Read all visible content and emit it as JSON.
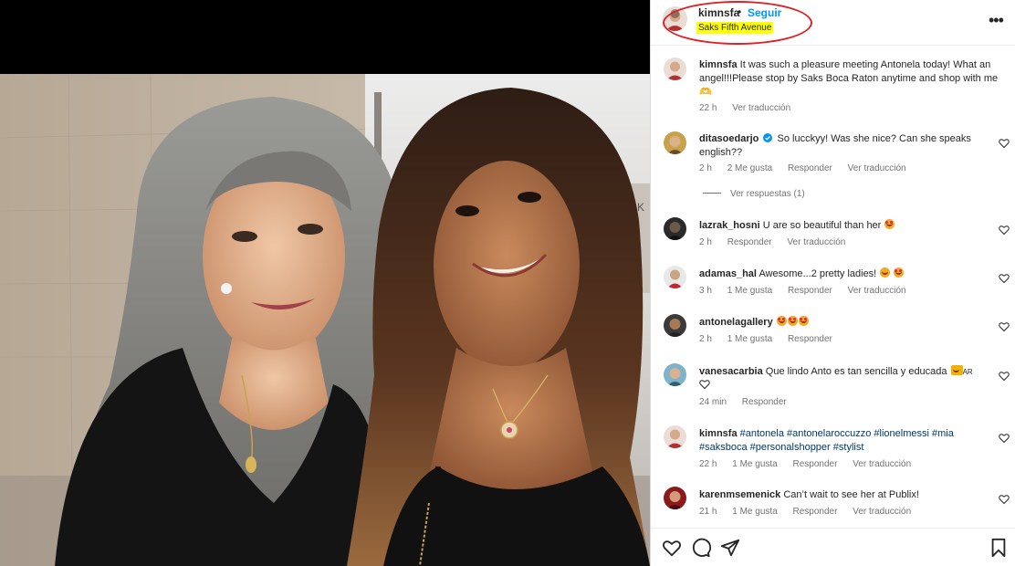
{
  "header": {
    "username": "kimnsfa",
    "separator": "•",
    "follow_label": "Seguir",
    "location": "Saks Fifth Avenue",
    "more_label": "•••"
  },
  "caption": {
    "username": "kimnsfa",
    "text": "It was such a pleasure meeting Antonela today! What an angel!!!Please stop by Saks Boca Raton anytime and shop with me 🫶",
    "time": "22 h",
    "translate": "Ver traducción"
  },
  "comments": [
    {
      "username": "ditasoedarjo",
      "verified": true,
      "text": "So lucckyy! Was she nice? Can she speaks english??",
      "time": "2 h",
      "likes": "2 Me gusta",
      "reply": "Responder",
      "translate": "Ver traducción",
      "view_replies": "Ver respuestas (1)"
    },
    {
      "username": "lazrak_hosni",
      "text": "U are so beautiful than her",
      "time": "2 h",
      "reply": "Responder",
      "translate": "Ver traducción"
    },
    {
      "username": "adamas_hal",
      "text": "Awesome...2 pretty ladies!",
      "time": "3 h",
      "likes": "1 Me gusta",
      "reply": "Responder",
      "translate": "Ver traducción"
    },
    {
      "username": "antonelagallery",
      "text": "",
      "time": "2 h",
      "likes": "1 Me gusta",
      "reply": "Responder"
    },
    {
      "username": "vanesacarbia",
      "text": "Que lindo Anto es tan sencilla y educada",
      "suffix": "AR",
      "time": "24 min",
      "reply": "Responder"
    },
    {
      "username": "kimnsfa",
      "hashtags_line1": "#antonela #antonelaroccuzzo #lionelmessi #mia",
      "hashtags_line2": "#saksboca #personalshopper #stylist",
      "time": "22 h",
      "likes": "1 Me gusta",
      "reply": "Responder",
      "translate": "Ver traducción"
    },
    {
      "username": "karenmsemenick",
      "text": "Can’t wait to see her at Publix!",
      "time": "21 h",
      "likes": "1 Me gusta",
      "reply": "Responder",
      "translate": "Ver traducción"
    }
  ],
  "icons": {
    "like": "heart-outline-icon",
    "comment": "comment-bubble-icon",
    "share": "paper-plane-icon",
    "save": "bookmark-icon"
  },
  "colors": {
    "link_blue": "#0095f6",
    "highlight_yellow": "#ffff00",
    "annotation_red": "#e01f27",
    "muted_text": "#737373"
  }
}
